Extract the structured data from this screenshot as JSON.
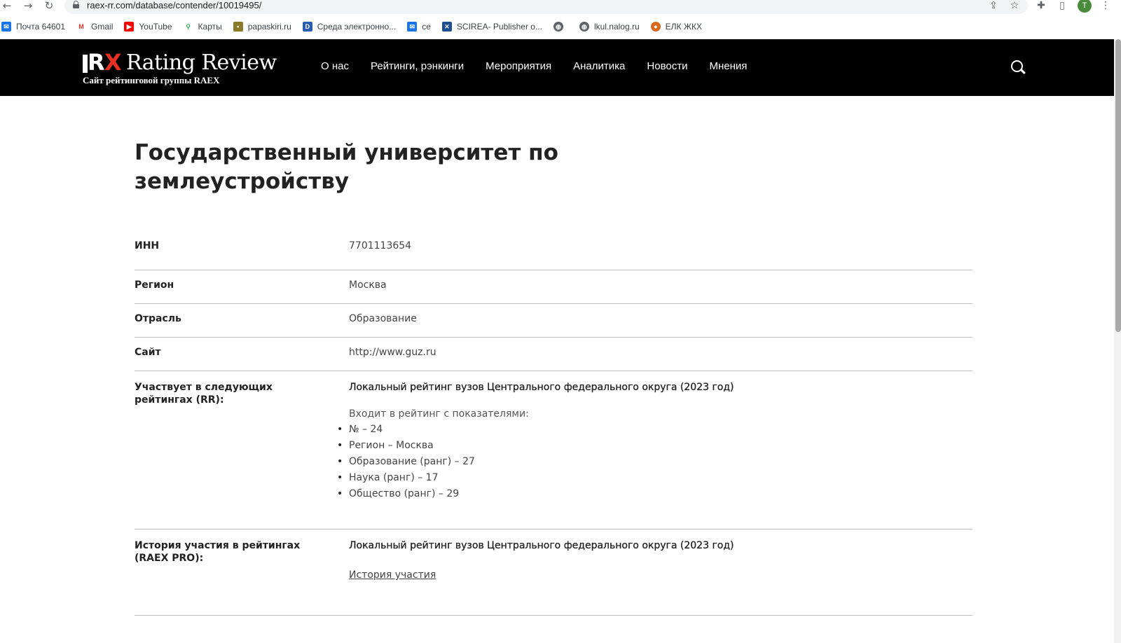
{
  "browser": {
    "url": "raex-rr.com/database/contender/10019495/",
    "profile_initial": "T",
    "bookmarks": [
      {
        "label": "Почта 64601",
        "icon": "mail-icon"
      },
      {
        "label": "Gmail",
        "icon": "gmail-icon"
      },
      {
        "label": "YouTube",
        "icon": "youtube-icon"
      },
      {
        "label": "Карты",
        "icon": "maps-icon"
      },
      {
        "label": "papaskiri.ru",
        "icon": "site-icon"
      },
      {
        "label": "Среда электронно...",
        "icon": "site-icon"
      },
      {
        "label": "ce",
        "icon": "mail-icon"
      },
      {
        "label": "SCIREA- Publisher o...",
        "icon": "site-icon"
      },
      {
        "label": "",
        "icon": "globe-icon"
      },
      {
        "label": "lkul.nalog.ru",
        "icon": "globe-icon"
      },
      {
        "label": "ЕЛК ЖКХ",
        "icon": "site-icon"
      }
    ]
  },
  "header": {
    "logo_title": "Rating Review",
    "logo_subtitle": "Сайт рейтинговой группы RAEX",
    "logo_mark_r": "R",
    "logo_mark_x": "X",
    "nav": [
      "О нас",
      "Рейтинги, рэнкинги",
      "Мероприятия",
      "Аналитика",
      "Новости",
      "Мнения"
    ]
  },
  "page": {
    "title": "Государственный университет по землеустройству"
  },
  "info": {
    "inn_label": "ИНН",
    "inn_value": "7701113654",
    "region_label": "Регион",
    "region_value": "Москва",
    "industry_label": "Отрасль",
    "industry_value": "Образование",
    "site_label": "Сайт",
    "site_value": "http://www.guz.ru",
    "ratings_label": "Участвует в следующих рейтингах (RR):",
    "ratings_name": "Локальный рейтинг вузов Центрального федерального округа (2023 год)",
    "ratings_note": "Входит в рейтинг с показателями:",
    "ratings_indicators": [
      "№ – 24",
      "Регион – Москва",
      "Образование (ранг) – 27",
      "Наука (ранг) – 17",
      "Общество (ранг) – 29"
    ],
    "history_label": "История участия в рейтингах (RAEX PRO):",
    "history_name": "Локальный рейтинг вузов Центрального федерального округа (2023 год)",
    "history_link": "История участия"
  },
  "colors": {
    "header_bg": "#000000",
    "accent_red": "#e63022",
    "link_red": "#d93025"
  }
}
